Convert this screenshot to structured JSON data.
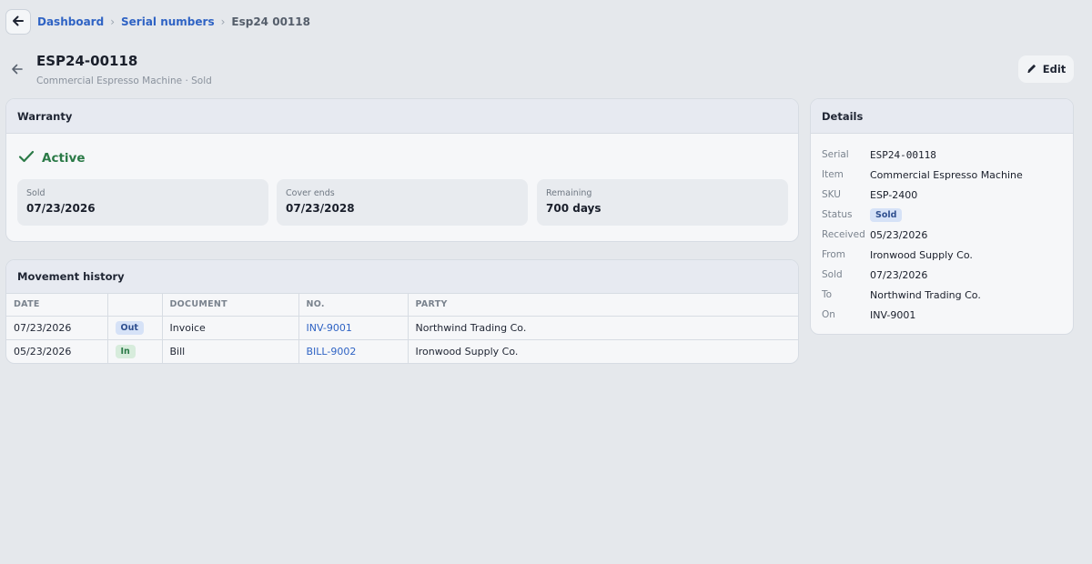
{
  "breadcrumb": {
    "items": [
      "Dashboard",
      "Serial numbers"
    ],
    "current": "Esp24 00118"
  },
  "header": {
    "title": "ESP24-00118",
    "subtitle": "Commercial Espresso Machine · Sold",
    "edit_label": "Edit"
  },
  "warranty": {
    "title": "Warranty",
    "status": "Active",
    "stats": [
      {
        "label": "Sold",
        "value": "07/23/2026"
      },
      {
        "label": "Cover ends",
        "value": "07/23/2028"
      },
      {
        "label": "Remaining",
        "value": "700 days"
      }
    ]
  },
  "movement": {
    "title": "Movement history",
    "columns": [
      "DATE",
      "",
      "DOCUMENT",
      "NO.",
      "PARTY"
    ],
    "rows": [
      {
        "date": "07/23/2026",
        "dir": "Out",
        "document": "Invoice",
        "no": "INV-9001",
        "party": "Northwind Trading Co."
      },
      {
        "date": "05/23/2026",
        "dir": "In",
        "document": "Bill",
        "no": "BILL-9002",
        "party": "Ironwood Supply Co."
      }
    ]
  },
  "details": {
    "title": "Details",
    "serial_label": "Serial",
    "serial": "ESP24-00118",
    "item_label": "Item",
    "item": "Commercial Espresso Machine",
    "sku_label": "SKU",
    "sku": "ESP-2400",
    "status_label": "Status",
    "status": "Sold",
    "received_label": "Received",
    "received": "05/23/2026",
    "from_label": "From",
    "from": "Ironwood Supply Co.",
    "sold_label": "Sold",
    "sold": "07/23/2026",
    "to_label": "To",
    "to": "Northwind Trading Co.",
    "on_label": "On",
    "on": "INV-9001"
  },
  "colors": {
    "accent": "#2f63c4",
    "success": "#2b7a47",
    "background": "#e5e8ec"
  },
  "icons": {
    "back": "arrow-left-icon",
    "edit": "pencil-icon",
    "active": "check-icon",
    "separator": "chevron-right-icon"
  }
}
